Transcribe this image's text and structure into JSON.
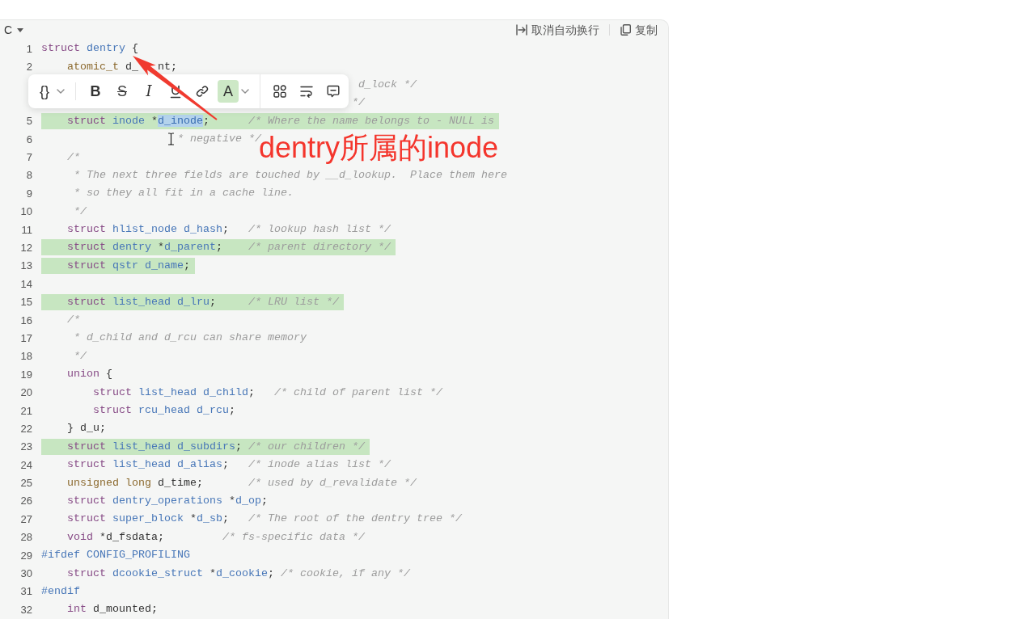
{
  "code_block": {
    "language": "C",
    "actions": [
      {
        "kind": "unwrap",
        "label": "取消自动换行"
      },
      {
        "kind": "copy",
        "label": "复制"
      }
    ],
    "lines": [
      {
        "number": "1",
        "highlighted": false,
        "tokens": [
          {
            "text": "struct",
            "kind": "keyword"
          },
          {
            "text": " dentry",
            "kind": "type"
          },
          {
            "text": " {",
            "kind": "plain"
          }
        ]
      },
      {
        "number": "2",
        "highlighted": false,
        "tokens": [
          {
            "text": "    atomic_t",
            "kind": "builtin"
          },
          {
            "text": " d_",
            "kind": "plain"
          },
          {
            "text": "   nt;",
            "kind": "plain"
          }
        ]
      },
      {
        "highlighted": false,
        "tokens": [
          {
            "text": "                                                 d_lock */",
            "kind": "comment"
          }
        ]
      },
      {
        "highlighted": false,
        "tokens": [
          {
            "text": "                                                */",
            "kind": "comment"
          }
        ]
      },
      {
        "number": "5",
        "highlighted": true,
        "tokens": [
          {
            "text": "    struct",
            "kind": "keyword"
          },
          {
            "text": " inode",
            "kind": "type"
          },
          {
            "text": " *",
            "kind": "plain"
          },
          {
            "text": "d_inode",
            "kind": "selection"
          },
          {
            "text": ";",
            "kind": "plain"
          },
          {
            "text": "      /* Where the name belongs to - NULL is",
            "kind": "comment"
          }
        ]
      },
      {
        "number": "6",
        "highlighted": false,
        "tokens": [
          {
            "text": "                     * negative */",
            "kind": "comment"
          }
        ]
      },
      {
        "number": "7",
        "highlighted": false,
        "tokens": [
          {
            "text": "    /*",
            "kind": "comment"
          }
        ]
      },
      {
        "number": "8",
        "highlighted": false,
        "tokens": [
          {
            "text": "     * The next three fields are touched by __d_lookup.  Place them here",
            "kind": "comment"
          }
        ]
      },
      {
        "number": "9",
        "highlighted": false,
        "tokens": [
          {
            "text": "     * so they all fit in a cache line.",
            "kind": "comment"
          }
        ]
      },
      {
        "number": "10",
        "highlighted": false,
        "tokens": [
          {
            "text": "     */",
            "kind": "comment"
          }
        ]
      },
      {
        "number": "11",
        "highlighted": false,
        "tokens": [
          {
            "text": "    struct",
            "kind": "keyword"
          },
          {
            "text": " hlist_node",
            "kind": "type"
          },
          {
            "text": " d_hash",
            "kind": "name"
          },
          {
            "text": ";",
            "kind": "plain"
          },
          {
            "text": "   /* lookup hash list */",
            "kind": "comment"
          }
        ]
      },
      {
        "number": "12",
        "highlighted": true,
        "tokens": [
          {
            "text": "    struct",
            "kind": "keyword"
          },
          {
            "text": " dentry",
            "kind": "type"
          },
          {
            "text": " *",
            "kind": "plain"
          },
          {
            "text": "d_parent",
            "kind": "name"
          },
          {
            "text": ";",
            "kind": "plain"
          },
          {
            "text": "    /* parent directory */",
            "kind": "comment"
          }
        ]
      },
      {
        "number": "13",
        "highlighted": true,
        "tokens": [
          {
            "text": "    struct",
            "kind": "keyword"
          },
          {
            "text": " qstr",
            "kind": "type"
          },
          {
            "text": " d_name",
            "kind": "name"
          },
          {
            "text": ";",
            "kind": "plain"
          }
        ]
      },
      {
        "number": "14",
        "highlighted": false
      },
      {
        "number": "15",
        "highlighted": true,
        "tokens": [
          {
            "text": "    struct",
            "kind": "keyword"
          },
          {
            "text": " list_head",
            "kind": "type"
          },
          {
            "text": " d_lru",
            "kind": "name"
          },
          {
            "text": ";",
            "kind": "plain"
          },
          {
            "text": "     /* LRU list */",
            "kind": "comment"
          }
        ]
      },
      {
        "number": "16",
        "highlighted": false,
        "tokens": [
          {
            "text": "    /*",
            "kind": "comment"
          }
        ]
      },
      {
        "number": "17",
        "highlighted": false,
        "tokens": [
          {
            "text": "     * d_child and d_rcu can share memory",
            "kind": "comment"
          }
        ]
      },
      {
        "number": "18",
        "highlighted": false,
        "tokens": [
          {
            "text": "     */",
            "kind": "comment"
          }
        ]
      },
      {
        "number": "19",
        "highlighted": false,
        "tokens": [
          {
            "text": "    union",
            "kind": "keyword"
          },
          {
            "text": " {",
            "kind": "plain"
          }
        ]
      },
      {
        "number": "20",
        "highlighted": false,
        "tokens": [
          {
            "text": "        struct",
            "kind": "keyword"
          },
          {
            "text": " list_head",
            "kind": "type"
          },
          {
            "text": " d_child",
            "kind": "name"
          },
          {
            "text": ";",
            "kind": "plain"
          },
          {
            "text": "   /* child of parent list */",
            "kind": "comment"
          }
        ]
      },
      {
        "number": "21",
        "highlighted": false,
        "tokens": [
          {
            "text": "        struct",
            "kind": "keyword"
          },
          {
            "text": " rcu_head",
            "kind": "type"
          },
          {
            "text": " d_rcu",
            "kind": "name"
          },
          {
            "text": ";",
            "kind": "plain"
          }
        ]
      },
      {
        "number": "22",
        "highlighted": false,
        "tokens": [
          {
            "text": "    } d_u;",
            "kind": "plain"
          }
        ]
      },
      {
        "number": "23",
        "highlighted": true,
        "tokens": [
          {
            "text": "    struct",
            "kind": "keyword"
          },
          {
            "text": " list_head",
            "kind": "type"
          },
          {
            "text": " d_subdirs",
            "kind": "name"
          },
          {
            "text": ";",
            "kind": "plain"
          },
          {
            "text": " /* our children */",
            "kind": "comment"
          }
        ]
      },
      {
        "number": "24",
        "highlighted": false,
        "tokens": [
          {
            "text": "    struct",
            "kind": "keyword"
          },
          {
            "text": " list_head",
            "kind": "type"
          },
          {
            "text": " d_alias",
            "kind": "name"
          },
          {
            "text": ";",
            "kind": "plain"
          },
          {
            "text": "   /* inode alias list */",
            "kind": "comment"
          }
        ]
      },
      {
        "number": "25",
        "highlighted": false,
        "tokens": [
          {
            "text": "    unsigned long",
            "kind": "builtin"
          },
          {
            "text": " d_time;",
            "kind": "plain"
          },
          {
            "text": "       /* used by d_revalidate */",
            "kind": "comment"
          }
        ]
      },
      {
        "number": "26",
        "highlighted": false,
        "tokens": [
          {
            "text": "    struct",
            "kind": "keyword"
          },
          {
            "text": " dentry_operations",
            "kind": "type"
          },
          {
            "text": " *",
            "kind": "plain"
          },
          {
            "text": "d_op",
            "kind": "name"
          },
          {
            "text": ";",
            "kind": "plain"
          }
        ]
      },
      {
        "number": "27",
        "highlighted": false,
        "tokens": [
          {
            "text": "    struct",
            "kind": "keyword"
          },
          {
            "text": " super_block",
            "kind": "type"
          },
          {
            "text": " *",
            "kind": "plain"
          },
          {
            "text": "d_sb",
            "kind": "name"
          },
          {
            "text": ";",
            "kind": "plain"
          },
          {
            "text": "   /* The root of the dentry tree */",
            "kind": "comment"
          }
        ]
      },
      {
        "number": "28",
        "highlighted": false,
        "tokens": [
          {
            "text": "    void",
            "kind": "keyword"
          },
          {
            "text": " *d_fsdata;",
            "kind": "plain"
          },
          {
            "text": "         /* fs-specific data */",
            "kind": "comment"
          }
        ]
      },
      {
        "number": "29",
        "highlighted": false,
        "tokens": [
          {
            "text": "#ifdef CONFIG_PROFILING",
            "kind": "directive"
          }
        ]
      },
      {
        "number": "30",
        "highlighted": false,
        "tokens": [
          {
            "text": "    struct",
            "kind": "keyword"
          },
          {
            "text": " dcookie_struct",
            "kind": "type"
          },
          {
            "text": " *",
            "kind": "plain"
          },
          {
            "text": "d_cookie",
            "kind": "name"
          },
          {
            "text": ";",
            "kind": "plain"
          },
          {
            "text": " /* cookie, if any */",
            "kind": "comment"
          }
        ]
      },
      {
        "number": "31",
        "highlighted": false,
        "tokens": [
          {
            "text": "#endif",
            "kind": "directive"
          }
        ]
      },
      {
        "number": "32",
        "highlighted": false,
        "tokens": [
          {
            "text": "    int",
            "kind": "keyword"
          },
          {
            "text": " d_mounted;",
            "kind": "plain"
          }
        ]
      }
    ]
  },
  "format_toolbar": {
    "groups": [
      {
        "buttons": [
          {
            "kind": "code",
            "label": "{}",
            "dropdown": true,
            "active": false
          }
        ]
      },
      {
        "buttons": [
          {
            "kind": "bold",
            "label": "B",
            "dropdown": false,
            "active": false
          },
          {
            "kind": "strikethrough",
            "label": "S",
            "dropdown": false,
            "active": false
          },
          {
            "kind": "italic",
            "label": "I",
            "dropdown": false,
            "active": false
          },
          {
            "kind": "underline",
            "dropdown": false,
            "active": false
          },
          {
            "kind": "link",
            "dropdown": false,
            "active": false
          },
          {
            "kind": "highlight",
            "label": "A",
            "dropdown": true,
            "active": true
          }
        ]
      },
      {
        "buttons": [
          {
            "kind": "apps",
            "dropdown": false,
            "active": false
          },
          {
            "kind": "wrap",
            "dropdown": false,
            "active": false
          },
          {
            "kind": "comment",
            "dropdown": false,
            "active": false
          }
        ]
      }
    ]
  },
  "annotation": {
    "text": "dentry所属的inode"
  }
}
